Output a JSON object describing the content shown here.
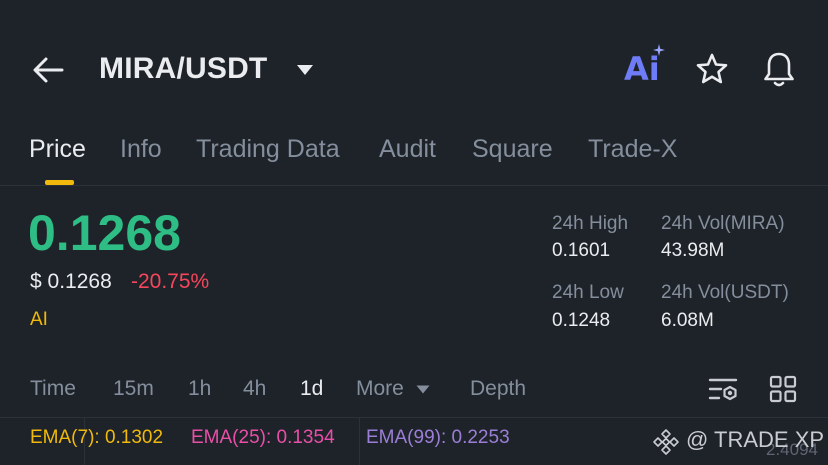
{
  "header": {
    "pair": "MIRA/USDT",
    "ai_label": "Ai"
  },
  "tabs": [
    {
      "label": "Price",
      "active": true
    },
    {
      "label": "Info"
    },
    {
      "label": "Trading Data"
    },
    {
      "label": "Audit"
    },
    {
      "label": "Square"
    },
    {
      "label": "Trade-X"
    }
  ],
  "price": {
    "last": "0.1268",
    "usd": "$ 0.1268",
    "change": "-20.75%",
    "ai_tag": "AI"
  },
  "stats": {
    "high_label": "24h High",
    "high_value": "0.1601",
    "vol_base_label": "24h Vol(MIRA)",
    "vol_base_value": "43.98M",
    "low_label": "24h Low",
    "low_value": "0.1248",
    "vol_quote_label": "24h Vol(USDT)",
    "vol_quote_value": "6.08M"
  },
  "timeframes": [
    {
      "label": "Time"
    },
    {
      "label": "15m"
    },
    {
      "label": "1h"
    },
    {
      "label": "4h"
    },
    {
      "label": "1d",
      "active": true
    },
    {
      "label": "More"
    },
    {
      "label": "Depth"
    }
  ],
  "ema": {
    "ema7": "EMA(7): 0.1302",
    "ema25": "EMA(25): 0.1354",
    "ema99": "EMA(99): 0.2253"
  },
  "watermark": "@ TRADE XP",
  "axis_value": "2.4094",
  "colors": {
    "background": "#1e2329",
    "up": "#2ebd85",
    "down": "#f6465d",
    "accent": "#f0b90b",
    "ema7": "#f0b90b",
    "ema25": "#e94fa8",
    "ema99": "#9b7fd6"
  },
  "icons": [
    "back-arrow-icon",
    "caret-down-icon",
    "ai-icon",
    "star-icon",
    "bell-icon",
    "chart-settings-icon",
    "grid-icon",
    "binance-logo-icon"
  ]
}
